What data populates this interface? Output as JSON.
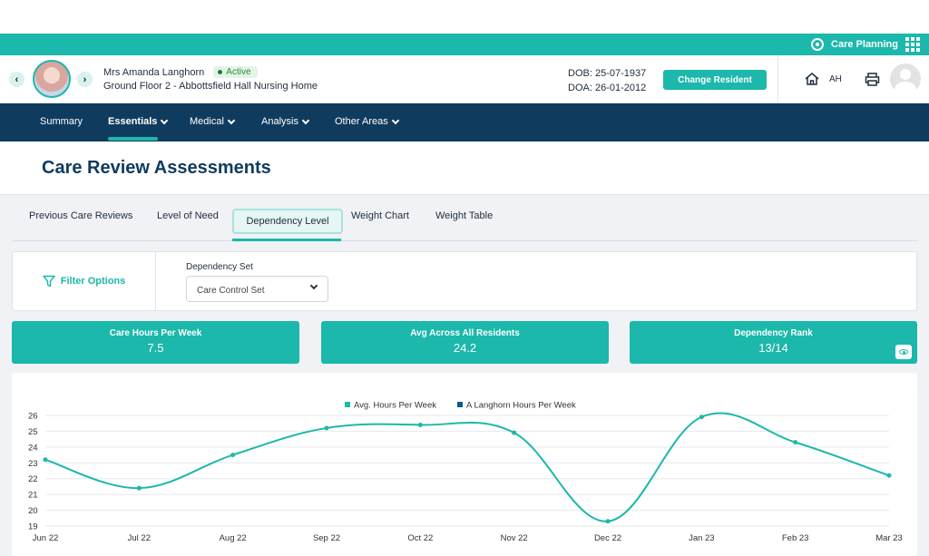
{
  "topbar": {
    "module_label": "Care Planning",
    "gear_icon": "gear-icon",
    "apps_icon": "grid-icon"
  },
  "resident": {
    "name": "Mrs Amanda Langhorn",
    "status": "Active",
    "location": "Ground Floor 2 - Abbottsfield Hall Nursing Home",
    "dob": "DOB: 25-07-1937",
    "doa": "DOA: 26-01-2012",
    "change_button": "Change Resident",
    "prev_icon": "chevron-left-icon",
    "next_icon": "chevron-right-icon"
  },
  "user": {
    "initials": "AH",
    "home_icon": "home-icon",
    "print_icon": "printer-icon"
  },
  "nav": [
    {
      "label": "Summary",
      "dropdown": false
    },
    {
      "label": "Essentials",
      "dropdown": true,
      "active": true
    },
    {
      "label": "Medical",
      "dropdown": true
    },
    {
      "label": "Analysis",
      "dropdown": true
    },
    {
      "label": "Other Areas",
      "dropdown": true
    }
  ],
  "page": {
    "title": "Care Review Assessments"
  },
  "tabs": [
    "Previous Care Reviews",
    "Level of Need",
    "Dependency Level",
    "Weight Chart",
    "Weight Table"
  ],
  "active_tab": "Dependency Level",
  "filter": {
    "label": "Filter Options",
    "dependency_label": "Dependency Set",
    "dependency_value": "Care Control Set"
  },
  "stats": [
    {
      "label": "Care Hours Per Week",
      "value": "7.5"
    },
    {
      "label": "Avg Across All Residents",
      "value": "24.2"
    },
    {
      "label": "Dependency Rank",
      "value": "13/14"
    }
  ],
  "colors": {
    "accent": "#1bb8ab",
    "nav": "#0f3b5e",
    "series2": "#0f5a8a"
  },
  "chart_data": {
    "type": "line",
    "legend_position": "top-center",
    "categories": [
      "Jun 22",
      "Jul 22",
      "Aug 22",
      "Sep 22",
      "Oct 22",
      "Nov 22",
      "Dec 22",
      "Jan 23",
      "Feb 23",
      "Mar 23"
    ],
    "series": [
      {
        "name": "Avg. Hours Per Week",
        "values": [
          23.2,
          21.4,
          23.5,
          25.2,
          25.4,
          24.9,
          19.3,
          25.9,
          24.3,
          22.2
        ]
      },
      {
        "name": "A Langhorn Hours Per Week",
        "values": []
      }
    ],
    "y_ticks": [
      19,
      20,
      21,
      22,
      23,
      24,
      25,
      26
    ],
    "ylim": [
      19,
      26
    ],
    "grid": true
  }
}
